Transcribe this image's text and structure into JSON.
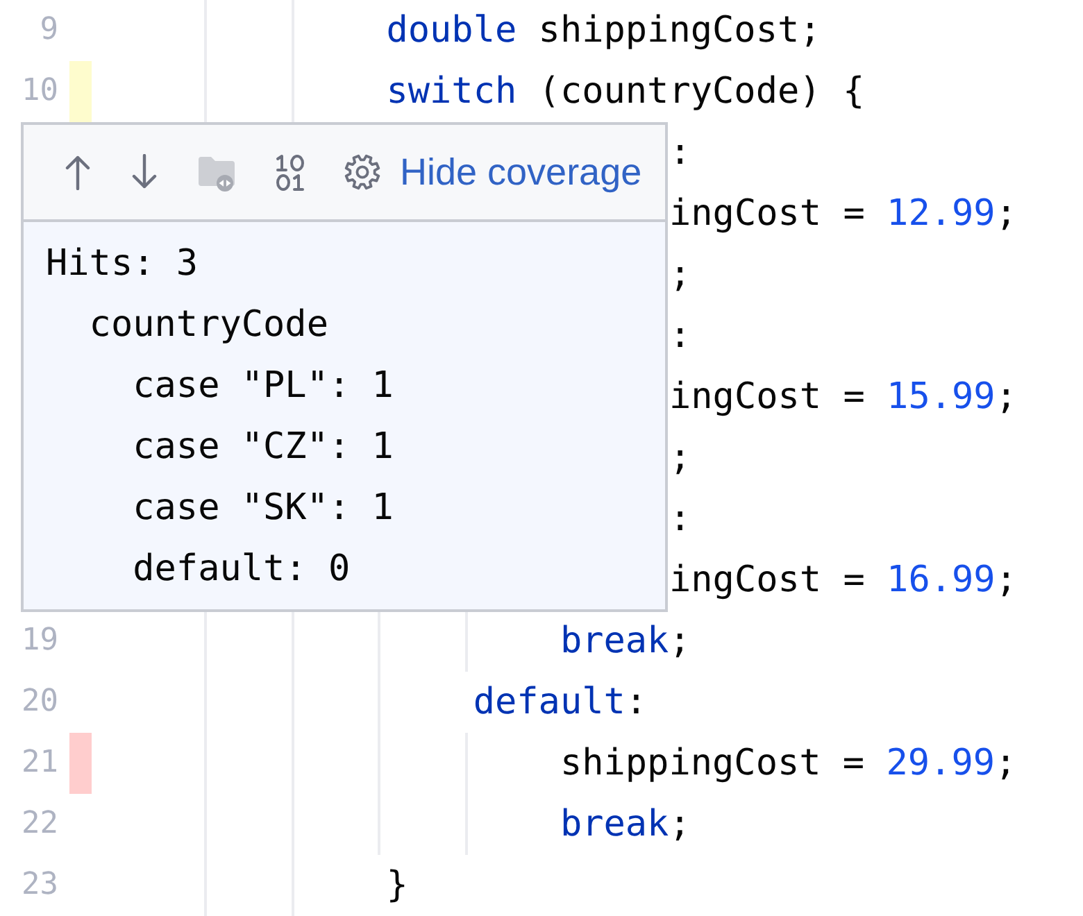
{
  "editor": {
    "lines": [
      {
        "number": "9",
        "kind": "code",
        "tokens": [
          {
            "kind": "keyword",
            "text": "double"
          },
          {
            "kind": "plain",
            "text": " shippingCost;"
          }
        ]
      },
      {
        "number": "10",
        "kind": "code",
        "coverage": {
          "color": "#fefccd"
        },
        "tokens": [
          {
            "kind": "keyword",
            "text": "switch"
          },
          {
            "kind": "plain",
            "text": " (countryCode) {"
          }
        ],
        "children": [
          {
            "kind": "clipped",
            "tokens": [
              {
                "kind": "plain",
                "text": ":"
              }
            ],
            "children": [
              {
                "kind": "clipped",
                "tokens": [
                  {
                    "kind": "plain",
                    "text": "ingCost = "
                  },
                  {
                    "kind": "number",
                    "text": "12.99"
                  },
                  {
                    "kind": "plain",
                    "text": ";"
                  }
                ]
              },
              {
                "kind": "clipped",
                "tokens": [
                  {
                    "kind": "plain",
                    "text": ";"
                  }
                ]
              }
            ]
          },
          {
            "kind": "clipped",
            "tokens": [
              {
                "kind": "plain",
                "text": ":"
              }
            ],
            "children": [
              {
                "kind": "clipped",
                "tokens": [
                  {
                    "kind": "plain",
                    "text": "ingCost = "
                  },
                  {
                    "kind": "number",
                    "text": "15.99"
                  },
                  {
                    "kind": "plain",
                    "text": ";"
                  }
                ]
              },
              {
                "kind": "clipped",
                "tokens": [
                  {
                    "kind": "plain",
                    "text": ";"
                  }
                ]
              }
            ]
          },
          {
            "kind": "clipped",
            "tokens": [
              {
                "kind": "plain",
                "text": ":"
              }
            ],
            "children": [
              {
                "kind": "clipped",
                "tokens": [
                  {
                    "kind": "plain",
                    "text": "ingCost = "
                  },
                  {
                    "kind": "number",
                    "text": "16.99"
                  },
                  {
                    "kind": "plain",
                    "text": ";"
                  }
                ]
              },
              {
                "number": "19",
                "kind": "code",
                "tokens": [
                  {
                    "kind": "keyword",
                    "text": "break"
                  },
                  {
                    "kind": "plain",
                    "text": ";"
                  }
                ]
              }
            ]
          },
          {
            "number": "20",
            "kind": "code",
            "tokens": [
              {
                "kind": "keyword",
                "text": "default"
              },
              {
                "kind": "plain",
                "text": ":"
              }
            ],
            "children": [
              {
                "number": "21",
                "kind": "code",
                "coverage": {
                  "color": "#ffcdcd"
                },
                "tokens": [
                  {
                    "kind": "plain",
                    "text": "shippingCost = "
                  },
                  {
                    "kind": "number",
                    "text": "29.99"
                  },
                  {
                    "kind": "plain",
                    "text": ";"
                  }
                ]
              },
              {
                "number": "22",
                "kind": "code",
                "tokens": [
                  {
                    "kind": "keyword",
                    "text": "break"
                  },
                  {
                    "kind": "plain",
                    "text": ";"
                  }
                ]
              }
            ]
          }
        ]
      },
      {
        "number": "23",
        "kind": "code",
        "tokens": [
          {
            "kind": "plain",
            "text": "}"
          }
        ]
      }
    ]
  },
  "popup": {
    "buttons": [
      {
        "disabled": false
      },
      {
        "disabled": false
      },
      {
        "disabled": true
      },
      {
        "disabled": false
      },
      {
        "disabled": false
      }
    ],
    "link": {
      "label": "Hide coverage"
    },
    "hits": [
      {
        "text": "Hits: 3",
        "children": [
          {
            "text": "countryCode",
            "children": [
              {
                "text": "case \"PL\": 1"
              },
              {
                "text": "case \"CZ\": 1"
              },
              {
                "text": "case \"SK\": 1"
              },
              {
                "text": "default: 0"
              }
            ]
          }
        ]
      }
    ]
  }
}
